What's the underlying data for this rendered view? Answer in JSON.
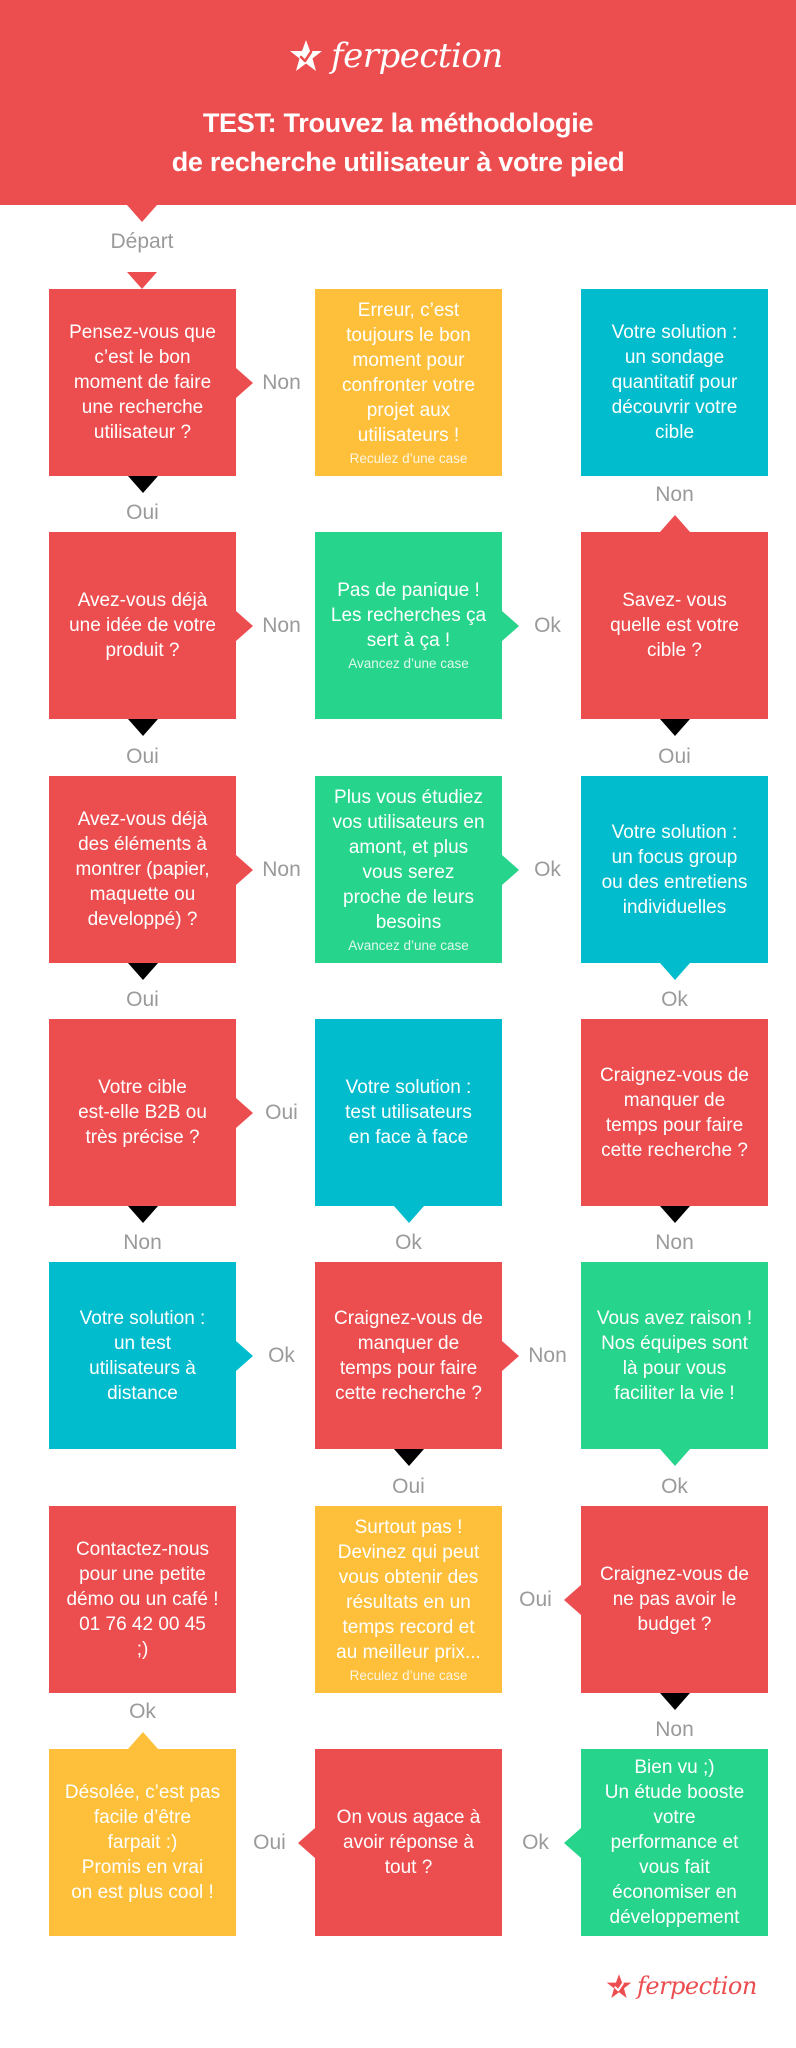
{
  "brand": {
    "name": "ferpection",
    "icon": "star-check-icon",
    "colors": {
      "red": "#ec4d4f",
      "yellow": "#fec03a",
      "teal": "#00bccd",
      "green": "#26d48c",
      "label_gray": "#9a9a9a"
    }
  },
  "header": {
    "title_line1": "TEST: Trouvez la méthodologie",
    "title_line2": "de recherche utilisateur à votre pied"
  },
  "start_label": "Départ",
  "nodes": [
    {
      "id": "r1c1",
      "type": "question",
      "text": "Pensez-vous que\nc’est le bon\nmoment de faire\nune recherche\nutilisateur ?"
    },
    {
      "id": "r1c2",
      "type": "error",
      "text": "Erreur, c’est\ntoujours le bon\nmoment pour\nconfronter votre\nprojet aux\nutilisateurs !",
      "note": "Reculez d’une case"
    },
    {
      "id": "r1c3",
      "type": "solution",
      "text": "Votre solution :\nun sondage\nquantitatif pour\ndécouvrir votre\ncible"
    },
    {
      "id": "r2c1",
      "type": "question",
      "text": "Avez-vous déjà\nune idée de votre\nproduit ?"
    },
    {
      "id": "r2c2",
      "type": "tip",
      "text": "Pas de panique !\nLes recherches ça\nsert à ça !",
      "note": "Avancez d’une case"
    },
    {
      "id": "r2c3",
      "type": "question",
      "text": "Savez- vous\nquelle est votre\ncible ?"
    },
    {
      "id": "r3c1",
      "type": "question",
      "text": "Avez-vous déjà\ndes éléments à\nmontrer (papier,\nmaquette ou\ndeveloppé) ?"
    },
    {
      "id": "r3c2",
      "type": "tip",
      "text": "Plus vous étudiez\nvos utilisateurs en\namont, et plus\nvous serez\nproche de leurs\nbesoins",
      "note": "Avancez d’une case"
    },
    {
      "id": "r3c3",
      "type": "solution",
      "text": "Votre solution :\nun focus group\nou des entretiens\nindividuelles"
    },
    {
      "id": "r4c1",
      "type": "question",
      "text": "Votre cible\nest-elle B2B ou\ntrès précise ?"
    },
    {
      "id": "r4c2",
      "type": "solution",
      "text": "Votre solution :\ntest utilisateurs\nen face à face"
    },
    {
      "id": "r4c3",
      "type": "question",
      "text": "Craignez-vous de\nmanquer de\ntemps pour faire\ncette recherche ?"
    },
    {
      "id": "r5c1",
      "type": "solution",
      "text": "Votre solution :\nun test\nutilisateurs à\ndistance"
    },
    {
      "id": "r5c2",
      "type": "question",
      "text": "Craignez-vous de\nmanquer de\ntemps pour faire\ncette recherche ?"
    },
    {
      "id": "r5c3",
      "type": "tip",
      "text": "Vous avez raison !\nNos équipes sont\nlà pour vous\nfaciliter la vie !"
    },
    {
      "id": "r6c1",
      "type": "question",
      "text": "Contactez-nous\npour une petite\ndémo ou un café !\n01 76 42 00 45\n;)"
    },
    {
      "id": "r6c2",
      "type": "error",
      "text": "Surtout pas !\nDevinez qui peut\nvous obtenir des\nrésultats en un\ntemps record et\nau meilleur prix...",
      "note": "Reculez d’une case"
    },
    {
      "id": "r6c3",
      "type": "question",
      "text": "Craignez-vous de\nne pas avoir le\nbudget ?"
    },
    {
      "id": "r7c1",
      "type": "error",
      "text": "Désolée, c’est pas\nfacile d’être\nfarpait :)\nPromis en vrai\non est plus cool !"
    },
    {
      "id": "r7c2",
      "type": "question",
      "text": "On vous agace à\navoir réponse à\ntout ?"
    },
    {
      "id": "r7c3",
      "type": "tip",
      "text": "Bien vu ;)\nUn étude booste\nvotre\nperformance et\nvous fait\néconomiser en\ndéveloppement"
    }
  ],
  "edges": [
    {
      "from": "r1c1",
      "to": "r1c2",
      "label": "Non"
    },
    {
      "from": "r1c1",
      "to": "r2c1",
      "label": "Oui"
    },
    {
      "from": "r2c3",
      "to": "r1c3",
      "label": "Non"
    },
    {
      "from": "r2c1",
      "to": "r2c2",
      "label": "Non"
    },
    {
      "from": "r2c2",
      "to": "r2c3",
      "label": "Ok"
    },
    {
      "from": "r2c1",
      "to": "r3c1",
      "label": "Oui"
    },
    {
      "from": "r2c3",
      "to": "r3c3",
      "label": "Oui"
    },
    {
      "from": "r3c1",
      "to": "r3c2",
      "label": "Non"
    },
    {
      "from": "r3c2",
      "to": "r3c3",
      "label": "Ok"
    },
    {
      "from": "r3c1",
      "to": "r4c1",
      "label": "Oui"
    },
    {
      "from": "r3c3",
      "to": "r4c3",
      "label": "Ok"
    },
    {
      "from": "r4c1",
      "to": "r4c2",
      "label": "Oui"
    },
    {
      "from": "r4c1",
      "to": "r5c1",
      "label": "Non"
    },
    {
      "from": "r4c2",
      "to": "r5c2",
      "label": "Ok"
    },
    {
      "from": "r4c3",
      "to": "r5c3",
      "label": "Non"
    },
    {
      "from": "r5c1",
      "to": "r5c2",
      "label": "Ok"
    },
    {
      "from": "r5c2",
      "to": "r5c3",
      "label": "Non"
    },
    {
      "from": "r5c2",
      "to": "r6c2",
      "label": "Oui"
    },
    {
      "from": "r5c3",
      "to": "r6c3",
      "label": "Ok"
    },
    {
      "from": "r6c3",
      "to": "r6c2",
      "label": "Oui"
    },
    {
      "from": "r6c3",
      "to": "r7c3",
      "label": "Non"
    },
    {
      "from": "r7c1",
      "to": "r6c1",
      "label": "Ok"
    },
    {
      "from": "r7c2",
      "to": "r7c1",
      "label": "Oui"
    },
    {
      "from": "r7c3",
      "to": "r7c2",
      "label": "Ok"
    }
  ]
}
